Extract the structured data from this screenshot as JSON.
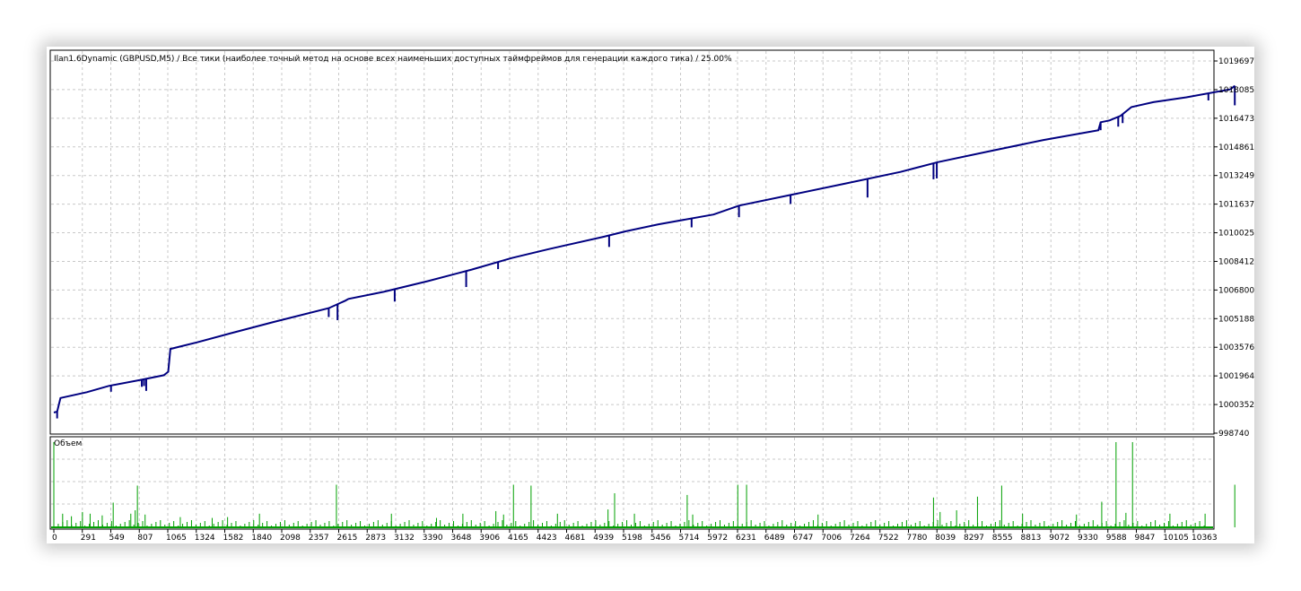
{
  "header": {
    "title": "Ilan1.6Dynamic (GBPUSD,M5) / Все тики (наиболее точный метод на основе всех наименьших доступных таймфреймов для генерации каждого тика) / 25.00%"
  },
  "volume_panel": {
    "label": "Объем"
  },
  "colors": {
    "balance_line": "#000080",
    "volume_bars": "#00a000",
    "grid": "#c8c8c8",
    "frame": "#000000",
    "background": "#ffffff"
  },
  "chart_data": [
    {
      "type": "line",
      "title": "Ilan1.6Dynamic (GBPUSD,M5) / Все тики (наиболее точный метод на основе всех наименьших доступных таймфреймов для генерации каждого тика) / 25.00%",
      "y_tick_labels": [
        "1019697",
        "1018085",
        "1016473",
        "1014861",
        "1013249",
        "1011637",
        "1010025",
        "1008412",
        "1006800",
        "1005188",
        "1003576",
        "1001964",
        "1000352",
        "998740"
      ],
      "ylim": [
        998740,
        1020100
      ],
      "x_tick_labels": [
        "0",
        "291",
        "549",
        "807",
        "1065",
        "1324",
        "1582",
        "1840",
        "2098",
        "2357",
        "2615",
        "2873",
        "3132",
        "3390",
        "3648",
        "3906",
        "4165",
        "4423",
        "4681",
        "4939",
        "5198",
        "5456",
        "5714",
        "5972",
        "6231",
        "6489",
        "6747",
        "7006",
        "7264",
        "7522",
        "7780",
        "8039",
        "8297",
        "8555",
        "8813",
        "9072",
        "9330",
        "9588",
        "9847",
        "10105",
        "10363"
      ],
      "xlim": [
        0,
        10755
      ],
      "grid": true,
      "series": [
        {
          "x": [
            0,
            30,
            60,
            300,
            500,
            800,
            1000,
            1040,
            1060,
            1300,
            1600,
            2000,
            2500,
            2650,
            2680,
            3000,
            3400,
            3800,
            4165,
            4500,
            5000,
            5198,
            5500,
            6000,
            6231,
            6700,
            7200,
            7700,
            8039,
            8500,
            9000,
            9500,
            9520,
            9600,
            9700,
            9800,
            10000,
            10300,
            10700,
            10740
          ],
          "y": [
            999900,
            999950,
            1000720,
            1001050,
            1001400,
            1001750,
            1002000,
            1002200,
            1003480,
            1003850,
            1004350,
            1005000,
            1005780,
            1006200,
            1006300,
            1006700,
            1007300,
            1007950,
            1008600,
            1009100,
            1009800,
            1010100,
            1010500,
            1011050,
            1011550,
            1012150,
            1012800,
            1013450,
            1014000,
            1014600,
            1015250,
            1015800,
            1016250,
            1016350,
            1016600,
            1017100,
            1017380,
            1017650,
            1018100,
            1018300
          ]
        }
      ],
      "drawdown_spikes": [
        {
          "x": 30,
          "depth": 380
        },
        {
          "x": 520,
          "depth": 350
        },
        {
          "x": 800,
          "depth": 400
        },
        {
          "x": 820,
          "depth": 380
        },
        {
          "x": 840,
          "depth": 680
        },
        {
          "x": 2500,
          "depth": 500
        },
        {
          "x": 2580,
          "depth": 900
        },
        {
          "x": 3100,
          "depth": 700
        },
        {
          "x": 3750,
          "depth": 900
        },
        {
          "x": 4040,
          "depth": 400
        },
        {
          "x": 5050,
          "depth": 650
        },
        {
          "x": 5800,
          "depth": 500
        },
        {
          "x": 6231,
          "depth": 650
        },
        {
          "x": 6700,
          "depth": 500
        },
        {
          "x": 7400,
          "depth": 1050
        },
        {
          "x": 8000,
          "depth": 900
        },
        {
          "x": 8030,
          "depth": 900
        },
        {
          "x": 9520,
          "depth": 450
        },
        {
          "x": 9680,
          "depth": 550
        },
        {
          "x": 9720,
          "depth": 500
        },
        {
          "x": 10500,
          "depth": 400
        },
        {
          "x": 10740,
          "depth": 1100
        }
      ]
    },
    {
      "type": "bar",
      "label": "Объем",
      "x": [
        0,
        80,
        160,
        260,
        330,
        440,
        540,
        700,
        740,
        760,
        830,
        1150,
        1440,
        1580,
        1870,
        2570,
        3070,
        3480,
        3720,
        4020,
        4090,
        4180,
        4340,
        4580,
        5040,
        5100,
        5280,
        5760,
        5810,
        6220,
        6300,
        6950,
        8000,
        8060,
        8210,
        8400,
        8620,
        8810,
        9300,
        9530,
        9660,
        9750,
        9810,
        10150,
        10470,
        10740
      ],
      "values": [
        1.0,
        0.16,
        0.13,
        0.18,
        0.16,
        0.14,
        0.29,
        0.16,
        0.2,
        0.49,
        0.15,
        0.12,
        0.11,
        0.12,
        0.16,
        0.5,
        0.16,
        0.11,
        0.16,
        0.19,
        0.15,
        0.5,
        0.49,
        0.16,
        0.21,
        0.4,
        0.16,
        0.38,
        0.15,
        0.5,
        0.5,
        0.15,
        0.35,
        0.18,
        0.2,
        0.36,
        0.49,
        0.16,
        0.15,
        0.3,
        1.0,
        0.17,
        1.0,
        0.16,
        0.16,
        0.5
      ]
    }
  ]
}
